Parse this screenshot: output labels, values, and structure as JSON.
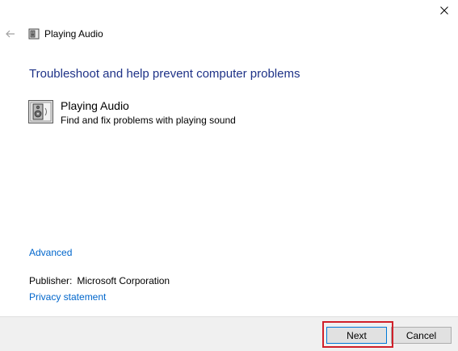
{
  "window": {
    "title": "Playing Audio",
    "icon": "speaker-document-icon"
  },
  "nav": {
    "back_icon": "arrow-left-icon",
    "close_icon": "close-icon"
  },
  "main": {
    "heading": "Troubleshoot and help prevent computer problems",
    "item": {
      "title": "Playing Audio",
      "description": "Find and fix problems with playing sound",
      "icon": "speaker-document-icon"
    },
    "advanced_link": "Advanced",
    "publisher_label": "Publisher:",
    "publisher_value": "Microsoft Corporation",
    "privacy_link": "Privacy statement"
  },
  "footer": {
    "next_label": "Next",
    "cancel_label": "Cancel"
  },
  "colors": {
    "heading": "#1e3287",
    "link": "#0066cc",
    "footer_bg": "#f0f0f0",
    "highlight": "#d0202a",
    "focus_border": "#0078d7"
  }
}
